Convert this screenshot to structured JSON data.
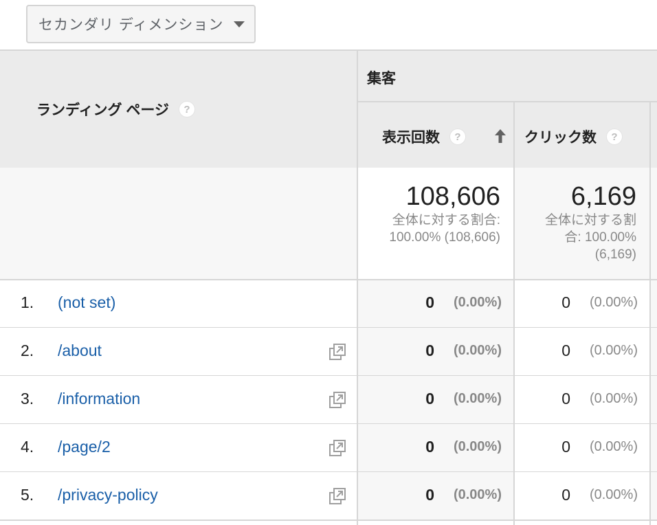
{
  "toolbar": {
    "secondary_dimension_label": "セカンダリ ディメンション",
    "secondary_dimension_icon": "caret-down-icon"
  },
  "header": {
    "dimension_label": "ランディング ページ",
    "group_label": "集客",
    "columns": [
      {
        "label": "表示回数",
        "sorted": "ascending"
      },
      {
        "label": "クリック数"
      }
    ],
    "help_glyph": "?"
  },
  "totals": {
    "impressions": {
      "value": "108,606",
      "line1": "全体に対する割合:",
      "line2": "100.00% (108,606)"
    },
    "clicks": {
      "value": "6,169",
      "line1": "全体に対する割",
      "line2": "合: 100.00%",
      "line3": "(6,169)"
    }
  },
  "rows": [
    {
      "index": "1.",
      "page": "(not set)",
      "has_link_icon": false,
      "impressions": "0",
      "impressions_pct": "(0.00%)",
      "clicks": "0",
      "clicks_pct": "(0.00%)"
    },
    {
      "index": "2.",
      "page": "/about",
      "has_link_icon": true,
      "impressions": "0",
      "impressions_pct": "(0.00%)",
      "clicks": "0",
      "clicks_pct": "(0.00%)"
    },
    {
      "index": "3.",
      "page": "/information",
      "has_link_icon": true,
      "impressions": "0",
      "impressions_pct": "(0.00%)",
      "clicks": "0",
      "clicks_pct": "(0.00%)"
    },
    {
      "index": "4.",
      "page": "/page/2",
      "has_link_icon": true,
      "impressions": "0",
      "impressions_pct": "(0.00%)",
      "clicks": "0",
      "clicks_pct": "(0.00%)"
    },
    {
      "index": "5.",
      "page": "/privacy-policy",
      "has_link_icon": true,
      "impressions": "0",
      "impressions_pct": "(0.00%)",
      "clicks": "0",
      "clicks_pct": "(0.00%)"
    }
  ],
  "colors": {
    "link": "#1a5fa8",
    "header_bg": "#ebebeb",
    "muted_text": "#888888"
  }
}
